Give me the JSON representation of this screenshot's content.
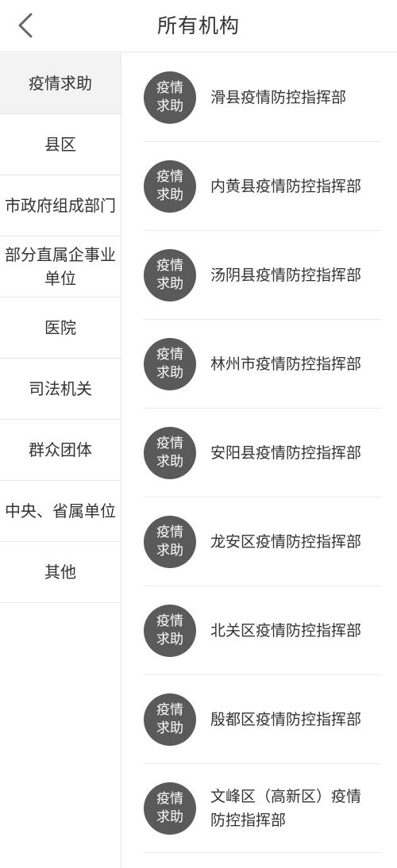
{
  "header": {
    "title": "所有机构",
    "back_icon": "chevron-left-icon"
  },
  "sidebar": {
    "items": [
      {
        "line1": "疫情求助",
        "line2": "",
        "active": true
      },
      {
        "line1": "县区",
        "line2": "",
        "active": false
      },
      {
        "line1": "市政府组成部门",
        "line2": "",
        "active": false
      },
      {
        "line1": "部分直属企事业",
        "line2": "单位",
        "active": false
      },
      {
        "line1": "医院",
        "line2": "",
        "active": false
      },
      {
        "line1": "司法机关",
        "line2": "",
        "active": false
      },
      {
        "line1": "群众团体",
        "line2": "",
        "active": false
      },
      {
        "line1": "中央、省属单位",
        "line2": "",
        "active": false
      },
      {
        "line1": "其他",
        "line2": "",
        "active": false
      }
    ]
  },
  "content": {
    "badge_line1": "疫情",
    "badge_line2": "求助",
    "badge_color": "#5a5a5a",
    "orgs": [
      {
        "line1": "滑县疫情防控指挥部",
        "line2": ""
      },
      {
        "line1": "内黄县疫情防控指挥部",
        "line2": ""
      },
      {
        "line1": "汤阴县疫情防控指挥部",
        "line2": ""
      },
      {
        "line1": "林州市疫情防控指挥部",
        "line2": ""
      },
      {
        "line1": "安阳县疫情防控指挥部",
        "line2": ""
      },
      {
        "line1": "龙安区疫情防控指挥部",
        "line2": ""
      },
      {
        "line1": "北关区疫情防控指挥部",
        "line2": ""
      },
      {
        "line1": "殷都区疫情防控指挥部",
        "line2": ""
      },
      {
        "line1": "文峰区（高新区）疫情",
        "line2": "防控指挥部"
      }
    ]
  }
}
